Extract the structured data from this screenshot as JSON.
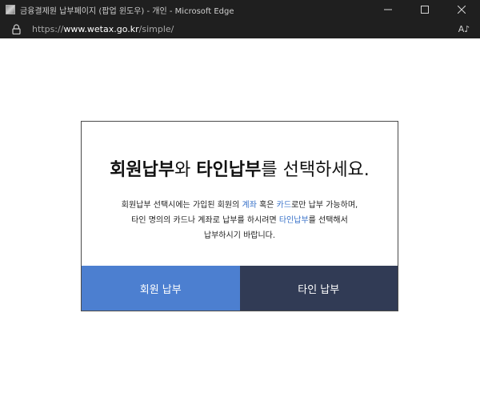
{
  "window": {
    "title": "금융결제원 납부페이지 (팝업 윈도우) - 개인 - Microsoft Edge",
    "controls": {
      "minimize_icon": "minimize-icon",
      "maximize_icon": "maximize-icon",
      "close_icon": "close-icon"
    }
  },
  "addressbar": {
    "scheme": "https://",
    "host": "www.wetax.go.kr",
    "path": "/simple/",
    "read_aloud_label": "A♪"
  },
  "dialog": {
    "headline": {
      "part1": "회원납부",
      "part2": "와 ",
      "part3": "타인납부",
      "part4": "를 선택하세요."
    },
    "description": {
      "line1_a": "회원납부 선택시에는 가입된 회원의 ",
      "line1_hl1": "계좌",
      "line1_b": " 혹은 ",
      "line1_hl2": "카드",
      "line1_c": "로만 납부 가능하며,",
      "line2_a": "타인 명의의 카드나 계좌로 납부를 하시려면 ",
      "line2_hl": "타인납부",
      "line2_b": "를 선택해서",
      "line3": "납부하시기 바랍니다."
    },
    "buttons": {
      "member": "회원 납부",
      "other": "타인 납부"
    }
  },
  "colors": {
    "member_button": "#4c7fd0",
    "other_button": "#313b55",
    "highlight": "#3a73c9",
    "titlebar": "#1f1f1f"
  }
}
